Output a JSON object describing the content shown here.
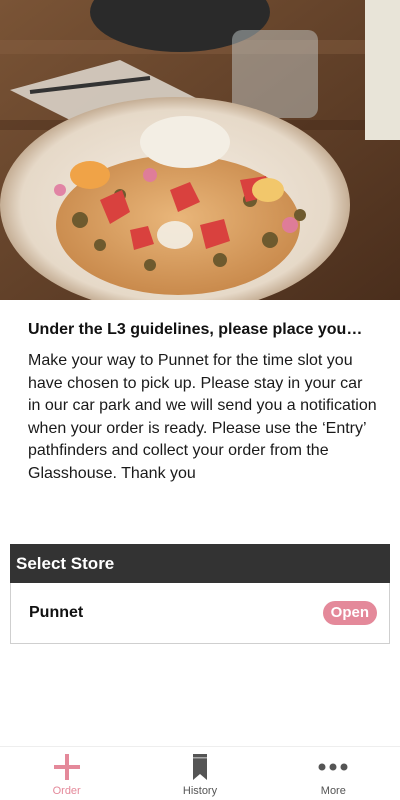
{
  "hero": {
    "image_name": "food-plate-photo"
  },
  "notice": {
    "headline": "Under the L3 guidelines, please place you…",
    "body": "Make your way to Punnet for the time slot you have chosen to pick up. Please stay in your car in our car park and we will send you a notification when your order is ready. Please use the ‘Entry’ pathfinders and collect your order from the Glasshouse. Thank you"
  },
  "stores": {
    "header": "Select Store",
    "items": [
      {
        "name": "Punnet",
        "status": "Open"
      }
    ]
  },
  "bottom_nav": {
    "items": [
      {
        "label": "Order",
        "icon": "plus-icon",
        "active": true
      },
      {
        "label": "History",
        "icon": "bookmark-icon",
        "active": false
      },
      {
        "label": "More",
        "icon": "more-dots-icon",
        "active": false
      }
    ]
  },
  "colors": {
    "accent": "#e4899a",
    "header_bg": "#333333",
    "inactive_icon": "#555555"
  }
}
